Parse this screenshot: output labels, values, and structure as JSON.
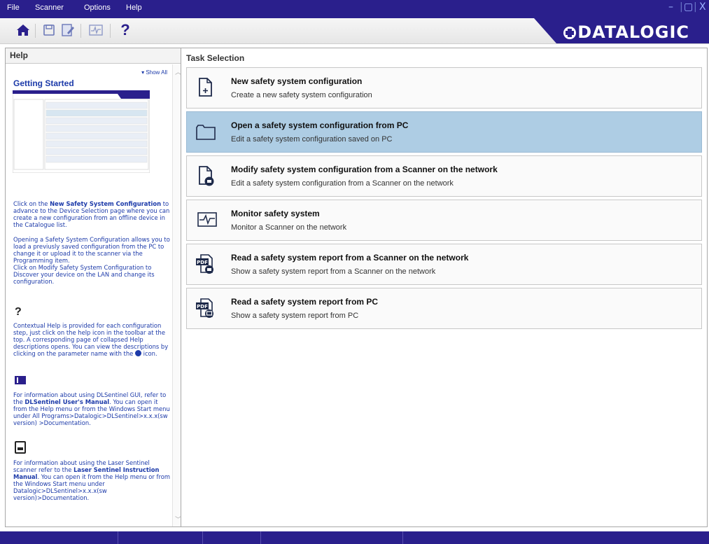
{
  "menu": {
    "file": "File",
    "scanner": "Scanner",
    "options": "Options",
    "help": "Help"
  },
  "window_controls": {
    "minimize": "–",
    "restore": "▢",
    "close": "X"
  },
  "toolbar": {
    "home_icon": "home-icon",
    "save_icon": "save-icon",
    "edit_icon": "edit-icon",
    "monitor_icon": "monitor-icon",
    "help_label": "?"
  },
  "logo": {
    "text": "DATALOGIC"
  },
  "help_panel": {
    "title": "Help",
    "show_all": "Show All",
    "getting_started": "Getting Started",
    "p1_a": "Click on the ",
    "p1_b": "New Safety System Configuration",
    "p1_c": " to advance to the Device Selection page where you can create a new configuration from an offline device in the Catalogue list.",
    "p2": "Opening a Safety System Configuration allows you to load a previusly saved configuration from the PC to change it or upload it to the scanner via the Programming item.",
    "p3": "Click on Modify Safety System Configuration to Discover your device on the LAN and change its configuration.",
    "help_icon_glyph": "?",
    "p4_a": "Contextual Help is provided for each configuration step, just click on the help icon in the toolbar at the top. A corresponding page of collapsed Help descriptions opens. You can view the descriptions by clicking on the parameter name with the ",
    "p4_b": " icon.",
    "p5_a": "For information about using DLSentinel GUI, refer to the ",
    "p5_b": "DLSentinel User's Manual",
    "p5_c": ". You can open it from the Help menu or from the Windows Start menu under All Programs>Datalogic>DLSentinel>x.x.x(sw version) >Documentation.",
    "p6_a": "For information about using the Laser Sentinel scanner refer to the ",
    "p6_b": "Laser Sentinel Instruction Manual",
    "p6_c": ". You can open it from the Help menu or from the Windows Start menu under Datalogic>DLSentinel>x.x.x(sw version)>Documentation."
  },
  "task_panel": {
    "title": "Task Selection",
    "tasks": [
      {
        "title": "New safety system configuration",
        "desc": "Create a new safety system configuration",
        "icon": "new-file-icon"
      },
      {
        "title": "Open a safety system configuration from PC",
        "desc": "Edit a safety system configuration saved on PC",
        "icon": "folder-icon"
      },
      {
        "title": "Modify safety system configuration from a Scanner on the network",
        "desc": "Edit a safety system configuration from a Scanner on the network",
        "icon": "scanner-file-icon"
      },
      {
        "title": "Monitor safety system",
        "desc": "Monitor a Scanner on the network",
        "icon": "monitor-icon"
      },
      {
        "title": "Read a safety system report from a Scanner on the network",
        "desc": "Show a safety system report from a Scanner on the network",
        "icon": "pdf-scanner-icon"
      },
      {
        "title": "Read a safety system report from PC",
        "desc": "Show a safety system report from PC",
        "icon": "pdf-pc-icon"
      }
    ],
    "selected_index": 1
  },
  "colors": {
    "brand_bar": "#2a1f8c",
    "selected_task": "#aecde4",
    "help_text": "#1c3aa9"
  }
}
